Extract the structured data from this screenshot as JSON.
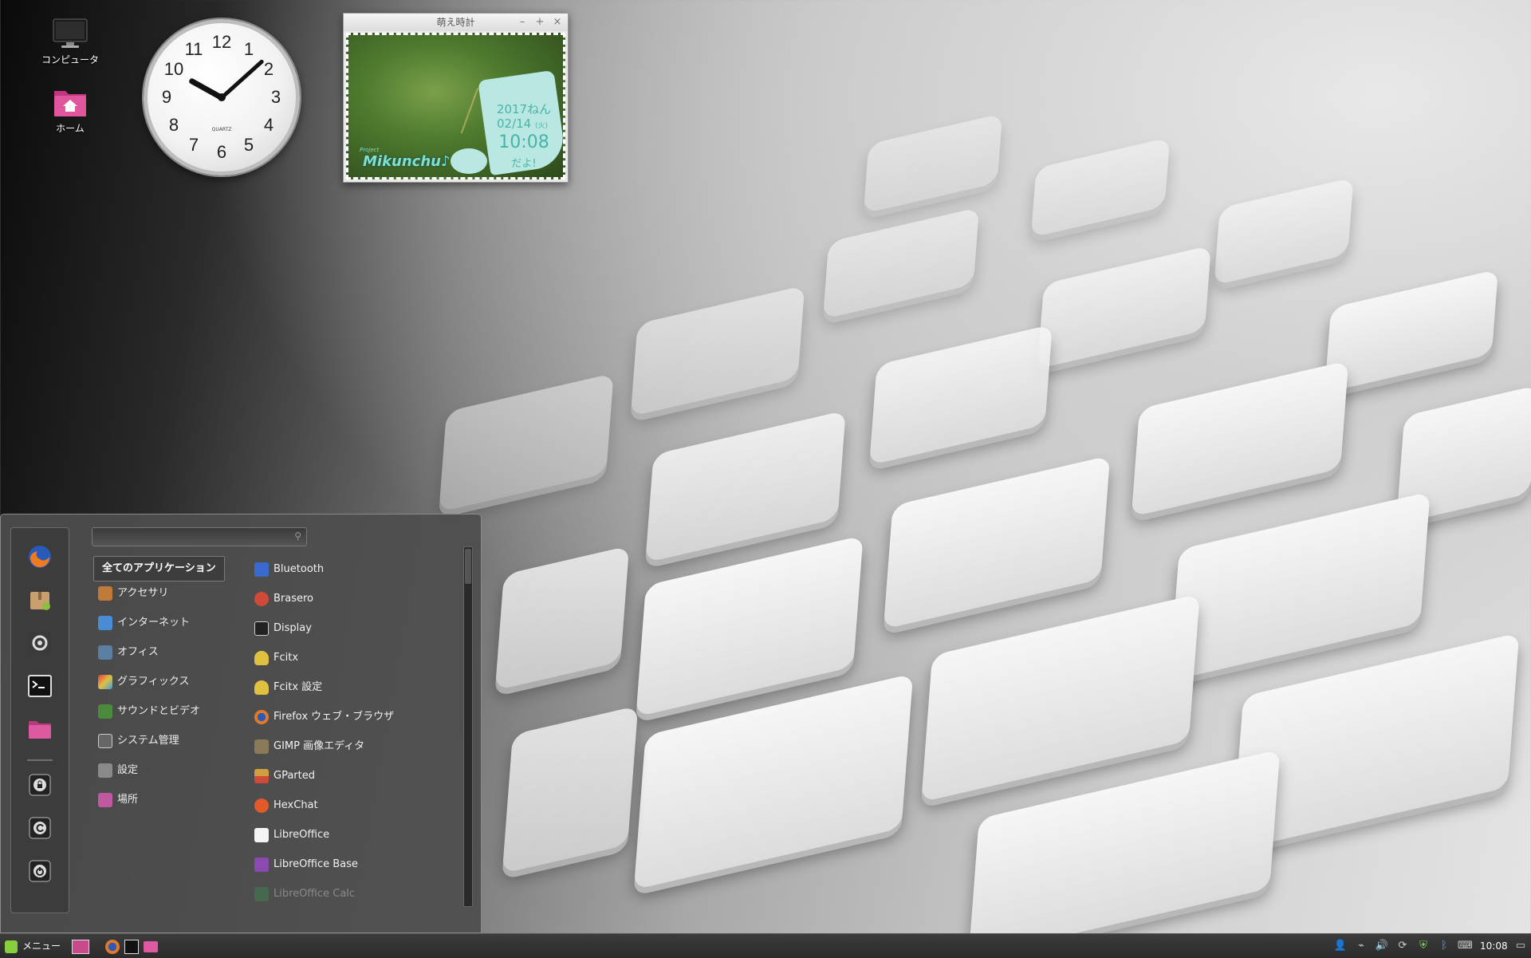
{
  "desktop": {
    "icons": [
      {
        "label": "コンピュータ",
        "icon": "computer-icon"
      },
      {
        "label": "ホーム",
        "icon": "home-folder-icon"
      }
    ]
  },
  "analog_clock": {
    "numbers": [
      "12",
      "1",
      "2",
      "3",
      "4",
      "5",
      "6",
      "7",
      "8",
      "9",
      "10",
      "11"
    ],
    "brand": "QUARTZ",
    "time": "10:08"
  },
  "moe_clock": {
    "title": "萌え時計",
    "controls": {
      "minimize": "–",
      "maximize": "+",
      "close": "×"
    },
    "year": "2017ねん",
    "date": "02/14",
    "weekday": "(火)",
    "time": "10:08",
    "suffix": "だよ!",
    "brand": "Mikunchu♪",
    "brand_small": "Project"
  },
  "menu": {
    "search_placeholder": "",
    "favorites": [
      "firefox-icon",
      "package-manager-icon",
      "system-settings-icon",
      "terminal-icon",
      "files-folder-icon"
    ],
    "session": [
      "lock-screen-icon",
      "logout-icon",
      "shutdown-icon"
    ],
    "categories": [
      {
        "label": "全てのアプリケーション",
        "icon": "",
        "selected": true
      },
      {
        "label": "アクセサリ",
        "icon": "accessories-icon",
        "color": "#c07a3a"
      },
      {
        "label": "インターネット",
        "icon": "internet-icon",
        "color": "#4a8bd6"
      },
      {
        "label": "オフィス",
        "icon": "office-icon",
        "color": "#5a7fa0"
      },
      {
        "label": "グラフィックス",
        "icon": "graphics-icon",
        "color": "#d6a03a"
      },
      {
        "label": "サウンドとビデオ",
        "icon": "sound-video-icon",
        "color": "#4a8a3a"
      },
      {
        "label": "システム管理",
        "icon": "system-admin-icon",
        "color": "#666666"
      },
      {
        "label": "設定",
        "icon": "settings-icon",
        "color": "#8a8a8a"
      },
      {
        "label": "場所",
        "icon": "places-icon",
        "color": "#c05aa0"
      }
    ],
    "apps": [
      {
        "label": "Bluetooth",
        "icon": "bluetooth-icon",
        "color": "#3a6ad0"
      },
      {
        "label": "Brasero",
        "icon": "brasero-icon",
        "color": "#d04a3a"
      },
      {
        "label": "Display",
        "icon": "display-icon",
        "color": "#222222"
      },
      {
        "label": "Fcitx",
        "icon": "penguin-icon",
        "color": "#e0c040"
      },
      {
        "label": "Fcitx 設定",
        "icon": "penguin-icon",
        "color": "#e0c040"
      },
      {
        "label": "Firefox ウェブ・ブラウザ",
        "icon": "firefox-icon",
        "color": "#e07a2a"
      },
      {
        "label": "GIMP 画像エディタ",
        "icon": "gimp-icon",
        "color": "#8a7a5a"
      },
      {
        "label": "GParted",
        "icon": "gparted-icon",
        "color": "#d0a040"
      },
      {
        "label": "HexChat",
        "icon": "hexchat-icon",
        "color": "#e05a2a"
      },
      {
        "label": "LibreOffice",
        "icon": "libreoffice-icon",
        "color": "#f4f4f4"
      },
      {
        "label": "LibreOffice Base",
        "icon": "libreoffice-base-icon",
        "color": "#8a4ab0"
      },
      {
        "label": "LibreOffice Calc",
        "icon": "libreoffice-calc-icon",
        "color": "#3a9a4a"
      }
    ]
  },
  "panel": {
    "menu_label": "メニュー",
    "launchers": [
      "show-desktop-icon",
      "firefox-icon",
      "terminal-icon",
      "files-folder-icon"
    ],
    "tray": [
      "user-icon",
      "network-icon",
      "volume-icon",
      "update-icon",
      "shield-icon",
      "bluetooth-icon",
      "keyboard-icon"
    ],
    "clock": "10:08",
    "notification": "notification-icon"
  },
  "colors": {
    "menu_bg": "#4e4e4e",
    "moe_accent": "#4ab3a8",
    "mint": "#87cf3e"
  }
}
